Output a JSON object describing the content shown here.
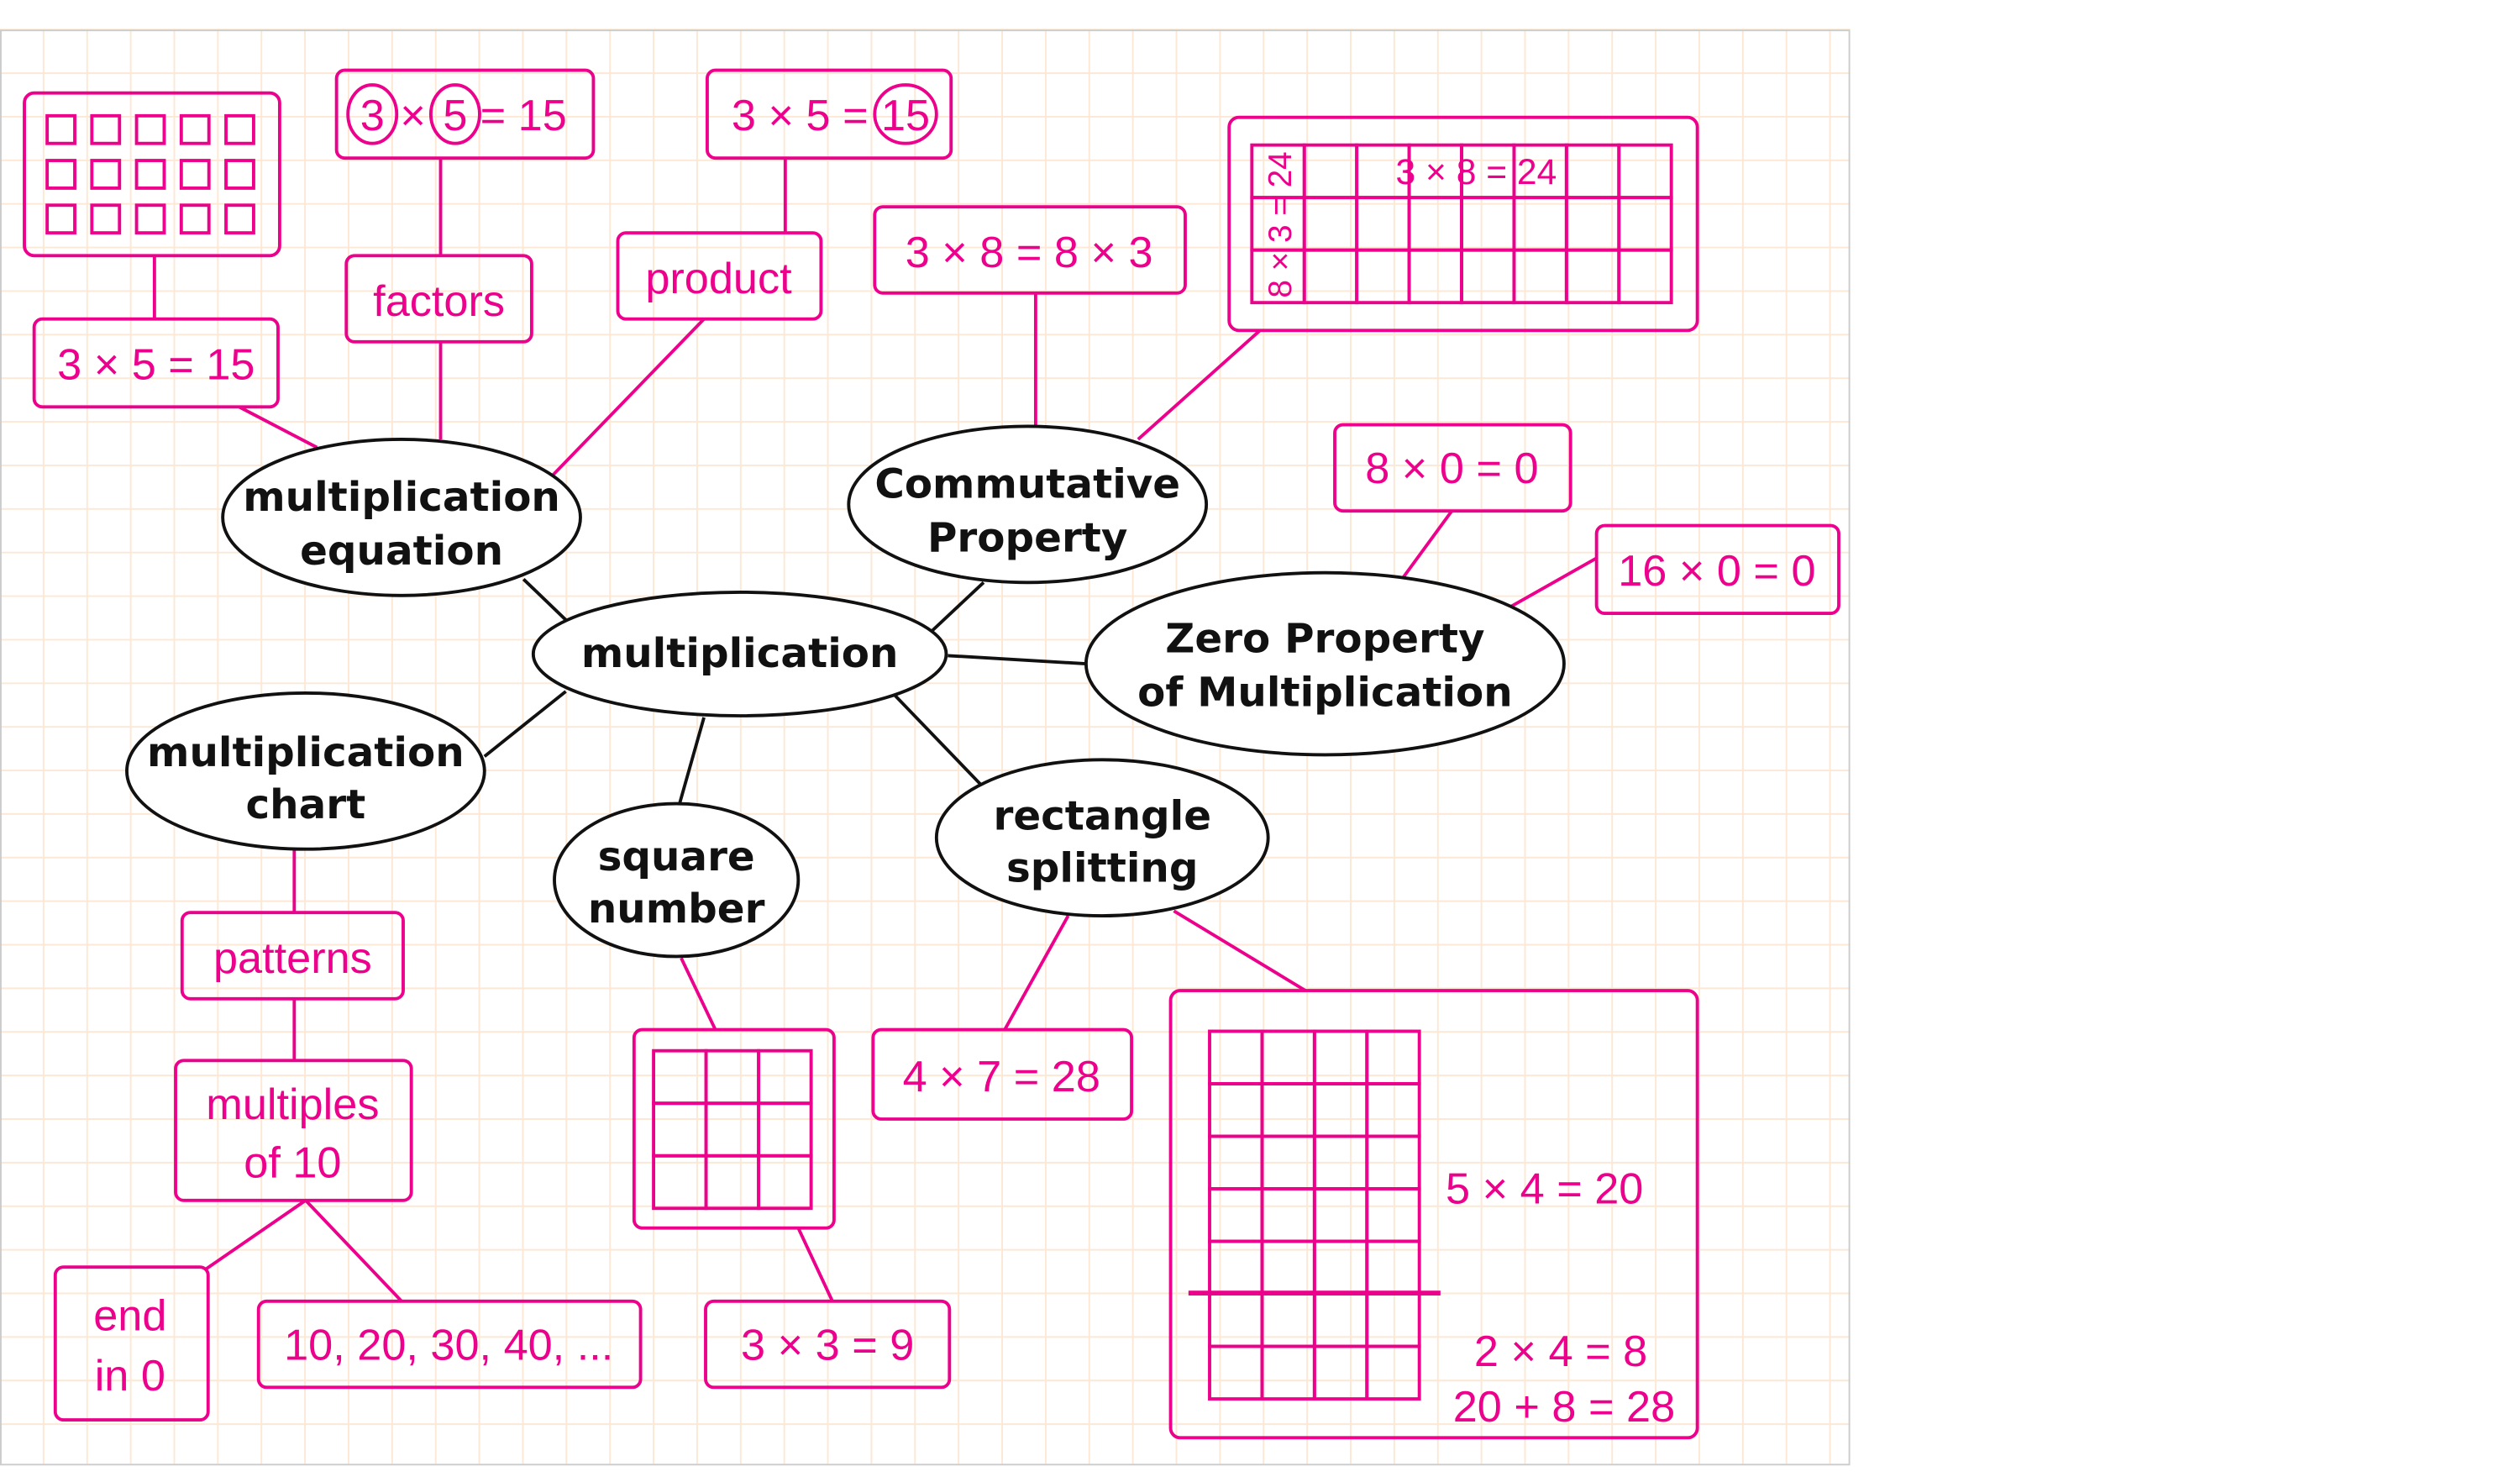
{
  "colors": {
    "accent": "#EC008C",
    "node_outline": "#111111",
    "grid": "#FCE8D4"
  },
  "center": "multiplication",
  "concepts": {
    "equation": [
      "multiplication",
      "equation"
    ],
    "commutative": [
      "Commutative",
      "Property"
    ],
    "zero": [
      "Zero Property",
      "of Multiplication"
    ],
    "chart": [
      "multiplication",
      "chart"
    ],
    "square": [
      "square",
      "number"
    ],
    "splitting": [
      "rectangle",
      "splitting"
    ]
  },
  "examples": {
    "eq_example": "3 × 5 = 15",
    "factors_eq": {
      "a": "3",
      "op": "×",
      "b": "5",
      "rest": "= 15"
    },
    "factors": "factors",
    "product_eq": {
      "lhs": "3 × 5 =",
      "c": "15"
    },
    "product": "product",
    "commutative_eq": "3 × 8 = 8 × 3",
    "array_top": "3 × 8 = 24",
    "array_side": "8 × 3 = 24",
    "zero1": "8 × 0 = 0",
    "zero2": "16 × 0 = 0",
    "patterns": "patterns",
    "multiples": [
      "multiples",
      "of 10"
    ],
    "end_in_0": [
      "end",
      "in 0"
    ],
    "multiples_list": "10, 20, 30, 40, ...",
    "square_eq": "3 × 3 = 9",
    "split_eq": "4 × 7 = 28",
    "split_top": "5 × 4 = 20",
    "split_bottom": "2 × 4 = 8",
    "split_sum": "20 + 8 = 28"
  }
}
